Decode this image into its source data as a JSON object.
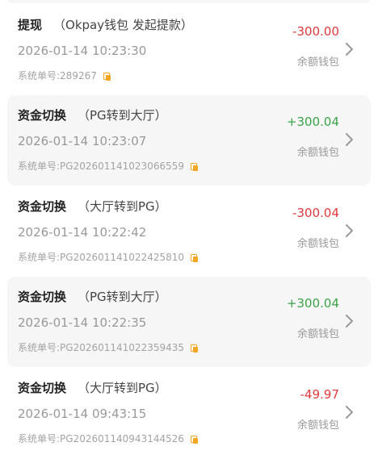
{
  "wallet_label": "余额钱包",
  "order_prefix": "系统单号: ",
  "colors": {
    "negative": "#e0393e",
    "positive": "#3aa34a",
    "copy_icon": "#f5a623",
    "card_bg": "#f6f6f6"
  },
  "records": [
    {
      "title": "提现",
      "subtitle": "（Okpay钱包 发起提款）",
      "time": "2026-01-14 10:23:30",
      "order_no": "289267",
      "amount": "-300.00",
      "direction": "negative",
      "wallet": "余额钱包"
    },
    {
      "title": "资金切换",
      "subtitle": "（PG转到大厅）",
      "time": "2026-01-14 10:23:07",
      "order_no": "PG202601141023066559",
      "amount": "+300.04",
      "direction": "positive",
      "wallet": "余额钱包"
    },
    {
      "title": "资金切换",
      "subtitle": "（大厅转到PG）",
      "time": "2026-01-14 10:22:42",
      "order_no": "PG202601141022425810",
      "amount": "-300.04",
      "direction": "negative",
      "wallet": "余额钱包"
    },
    {
      "title": "资金切换",
      "subtitle": "（PG转到大厅）",
      "time": "2026-01-14 10:22:35",
      "order_no": "PG202601141022359435",
      "amount": "+300.04",
      "direction": "positive",
      "wallet": "余额钱包"
    },
    {
      "title": "资金切换",
      "subtitle": "（大厅转到PG）",
      "time": "2026-01-14 09:43:15",
      "order_no": "PG202601140943144526",
      "amount": "-49.97",
      "direction": "negative",
      "wallet": "余额钱包"
    }
  ]
}
